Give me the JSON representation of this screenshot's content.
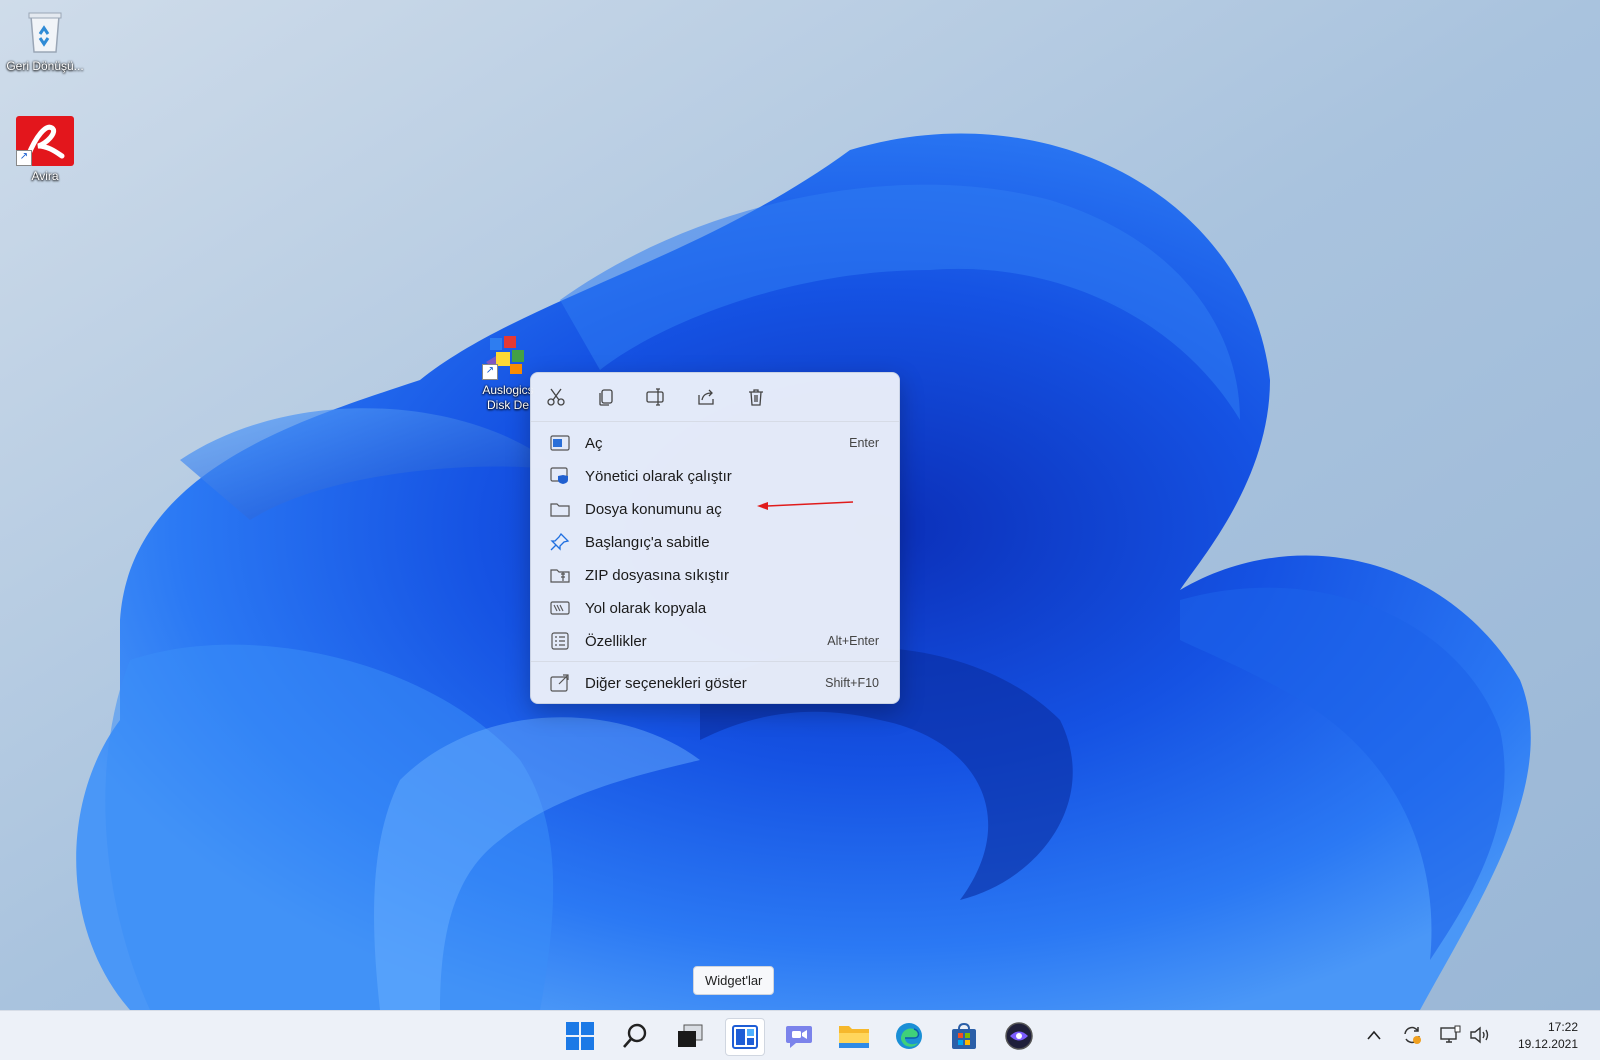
{
  "desktop": {
    "icons": [
      {
        "name": "recycle-bin",
        "label": "Geri Dönüşü..."
      },
      {
        "name": "avira",
        "label": "Avira"
      },
      {
        "name": "auslogics",
        "label": "Auslogics Disk De"
      }
    ]
  },
  "context_menu": {
    "toolbar": [
      "cut-icon",
      "copy-icon",
      "rename-icon",
      "share-icon",
      "delete-icon"
    ],
    "items": [
      {
        "label": "Aç",
        "shortcut": "Enter",
        "icon": "open-icon"
      },
      {
        "label": "Yönetici olarak çalıştır",
        "shortcut": "",
        "icon": "admin-shield-icon"
      },
      {
        "label": "Dosya konumunu aç",
        "shortcut": "",
        "icon": "folder-icon"
      },
      {
        "label": "Başlangıç'a sabitle",
        "shortcut": "",
        "icon": "pin-icon"
      },
      {
        "label": "ZIP dosyasına sıkıştır",
        "shortcut": "",
        "icon": "zip-icon"
      },
      {
        "label": "Yol olarak kopyala",
        "shortcut": "",
        "icon": "copy-path-icon"
      },
      {
        "label": "Özellikler",
        "shortcut": "Alt+Enter",
        "icon": "properties-icon"
      },
      {
        "label": "Diğer seçenekleri göster",
        "shortcut": "Shift+F10",
        "icon": "more-options-icon"
      }
    ]
  },
  "tooltip": "Widget'lar",
  "taskbar": {
    "apps": [
      "start-icon",
      "search-icon",
      "task-view-icon",
      "widgets-icon",
      "teams-chat-icon",
      "file-explorer-icon",
      "edge-icon",
      "store-icon",
      "app-icon"
    ],
    "tray": [
      "chevron-up-icon",
      "sync-icon",
      "network-icon",
      "volume-icon"
    ],
    "time": "17:22",
    "date": "19.12.2021"
  },
  "colors": {
    "accent": "#1a6fe0",
    "annotation_arrow": "#e01b1b"
  }
}
